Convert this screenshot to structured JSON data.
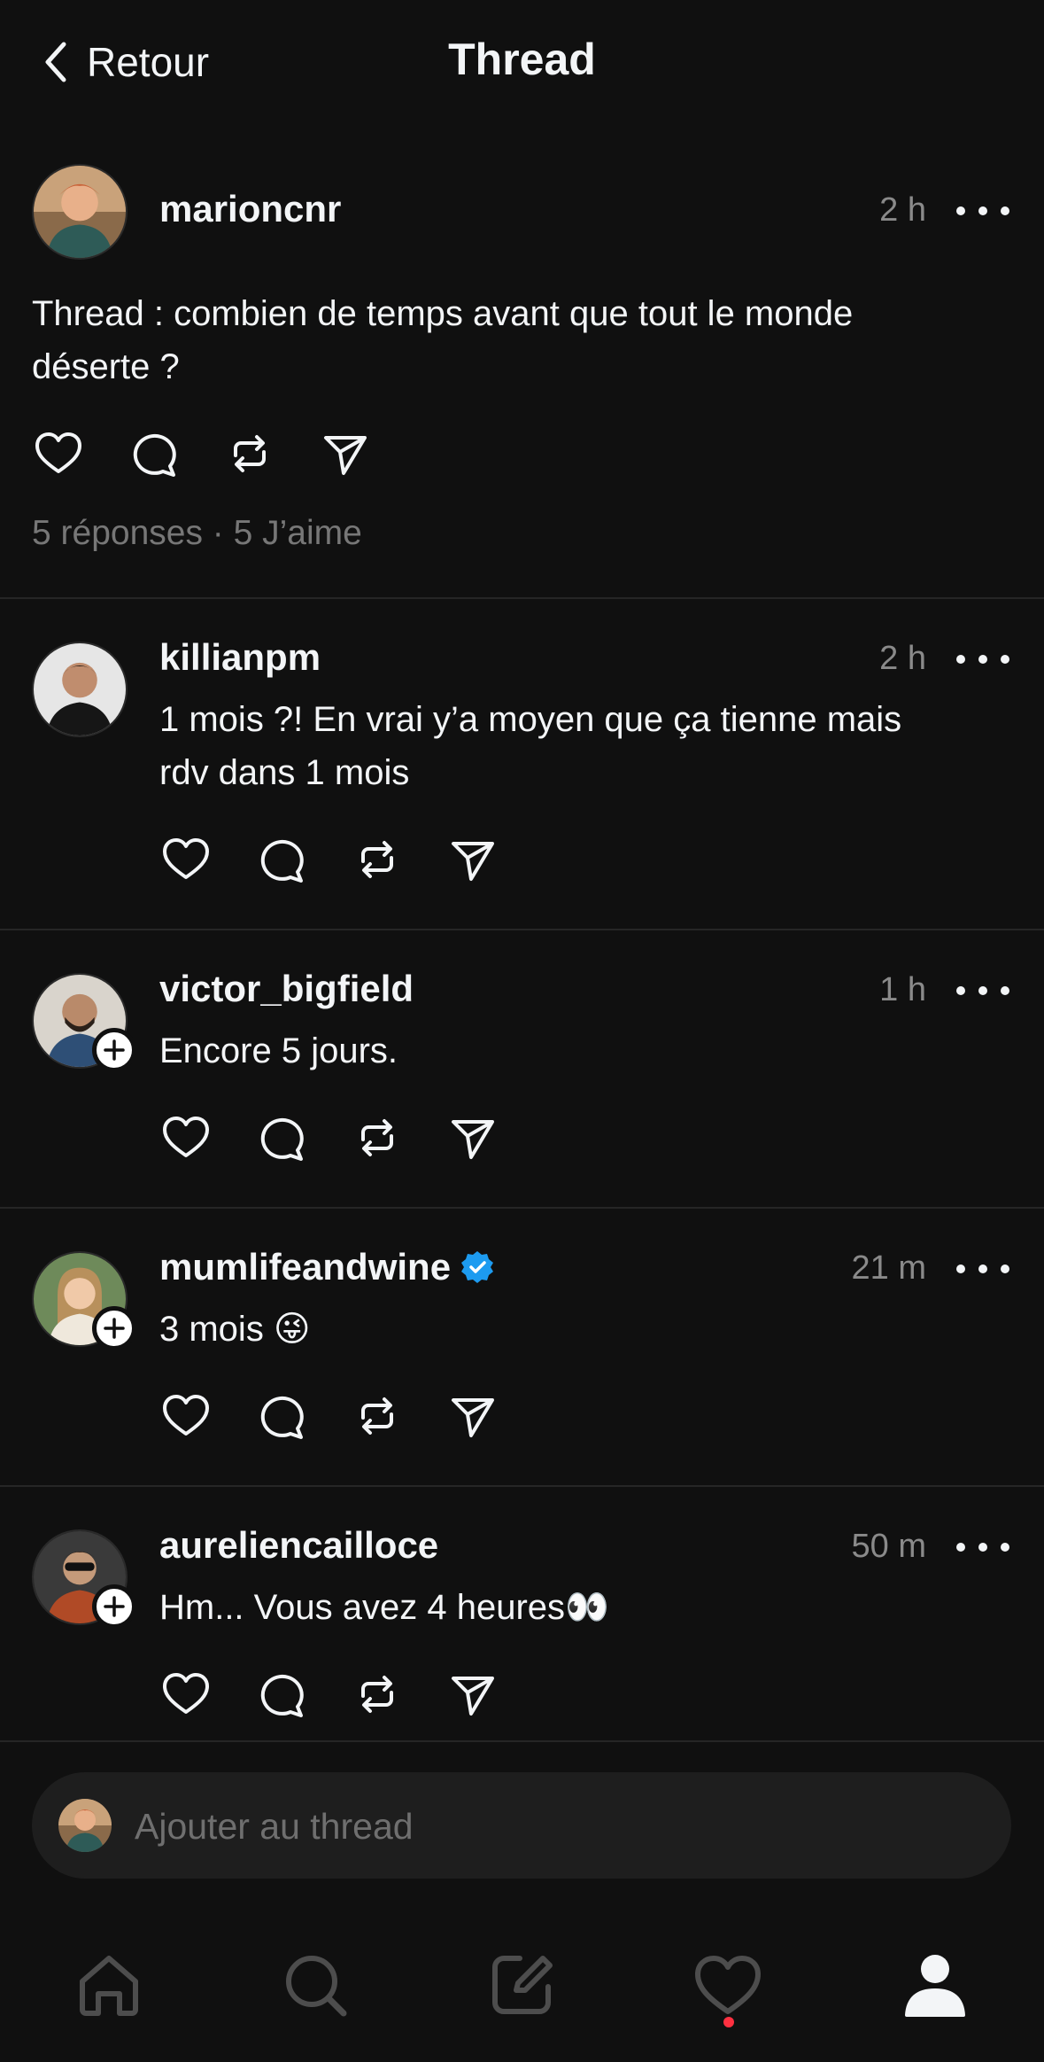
{
  "header": {
    "back_label": "Retour",
    "title": "Thread"
  },
  "main_post": {
    "username": "marioncnr",
    "time": "2 h",
    "text_line1": "Thread : combien de temps avant que tout le monde",
    "text_line2": "déserte ?",
    "stats": "5 réponses · 5 J’aime"
  },
  "replies": [
    {
      "username": "killianpm",
      "time": "2 h",
      "text_line1": "1 mois ?! En vrai y’a moyen que ça tienne mais",
      "text_line2": "rdv dans 1 mois",
      "follow": false,
      "verified": false
    },
    {
      "username": "victor_bigfield",
      "time": "1 h",
      "text_line1": "Encore 5 jours.",
      "follow": true,
      "verified": false
    },
    {
      "username": "mumlifeandwine",
      "time": "21 m",
      "text_line1": "3 mois 😜",
      "follow": true,
      "verified": true
    },
    {
      "username": "aureliencailloce",
      "time": "50 m",
      "text_line1": "Hm... Vous avez 4 heures👀",
      "follow": true,
      "verified": false
    }
  ],
  "composer": {
    "placeholder": "Ajouter au thread"
  },
  "nav": {
    "items": [
      "home-icon",
      "search-icon",
      "compose-icon",
      "activity-heart-icon",
      "profile-icon"
    ],
    "active": "profile-icon",
    "notification_color": "#ff3040"
  },
  "colors": {
    "background": "#101010",
    "text": "#f3f5f7",
    "muted": "#8a8a8a",
    "verified": "#1d9bf0"
  }
}
